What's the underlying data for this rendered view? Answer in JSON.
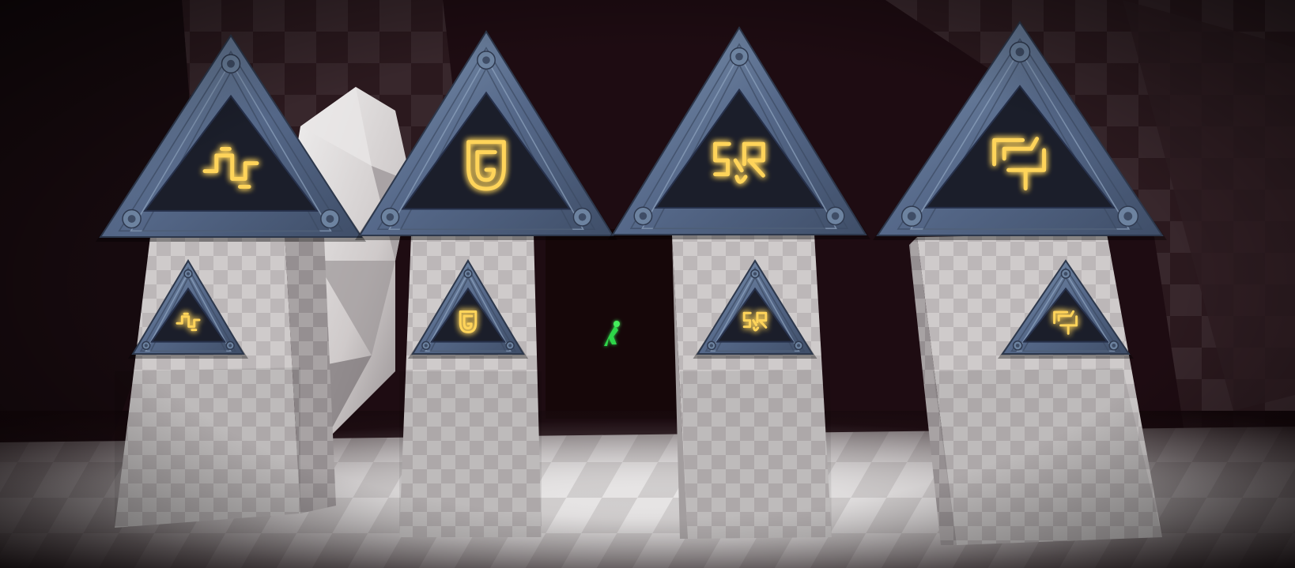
{
  "scene": {
    "type": "3d-puzzle-room",
    "background_color": "#1e0c12",
    "wall_color": "#3a2a2e",
    "floor_color": "#bdb9b9",
    "pedestal_color": "#c9c5c5",
    "frame_color": "#5f7592",
    "glyph_color": "#ffd45a"
  },
  "shrines": [
    {
      "name": "shrine-1",
      "glyph": "squiggle-glyph"
    },
    {
      "name": "shrine-2",
      "glyph": "shield-glyph"
    },
    {
      "name": "shrine-3",
      "glyph": "face-glyph"
    },
    {
      "name": "shrine-4",
      "glyph": "branch-glyph"
    }
  ],
  "character": {
    "name": "player-character",
    "color": "#2fd64a"
  }
}
